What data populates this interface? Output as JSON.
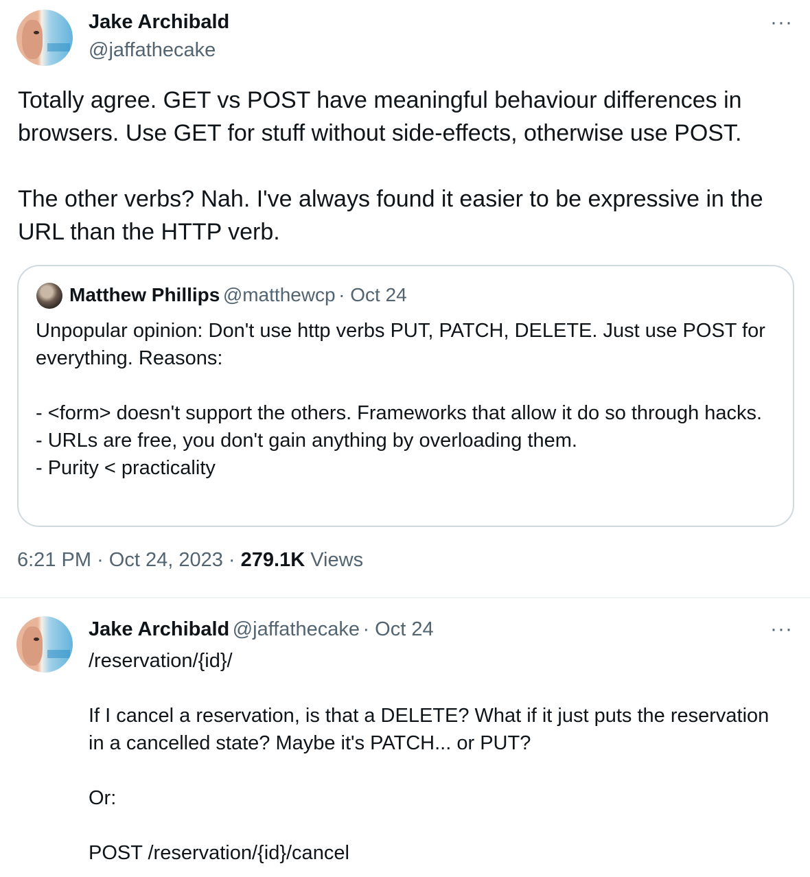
{
  "main_tweet": {
    "author_name": "Jake Archibald",
    "author_handle": "@jaffathecake",
    "more_label": "···",
    "text": "Totally agree. GET vs POST have meaningful behaviour differences in browsers. Use GET for stuff without side-effects, otherwise use POST.\n\nThe other verbs? Nah. I've always found it easier to be expressive in the URL than the HTTP verb.",
    "time": "6:21 PM",
    "date": "Oct 24, 2023",
    "separator": "·",
    "views_count": "279.1K",
    "views_label": "Views"
  },
  "quoted_tweet": {
    "author_name": "Matthew Phillips",
    "author_handle": "@matthewcp",
    "date": "· Oct 24",
    "text": "Unpopular opinion: Don't use http verbs PUT, PATCH, DELETE. Just use POST for everything. Reasons:\n\n- <form> doesn't support the others. Frameworks that allow it do so through hacks.\n- URLs are free, you don't gain anything by overloading them.\n- Purity < practicality"
  },
  "reply_tweet": {
    "author_name": "Jake Archibald",
    "author_handle": "@jaffathecake",
    "date": "· Oct 24",
    "more_label": "···",
    "text": "/reservation/{id}/\n\nIf I cancel a reservation, is that a DELETE? What if it just puts the reservation in a cancelled state? Maybe it's PATCH... or PUT?\n\nOr:\n\nPOST /reservation/{id}/cancel"
  }
}
